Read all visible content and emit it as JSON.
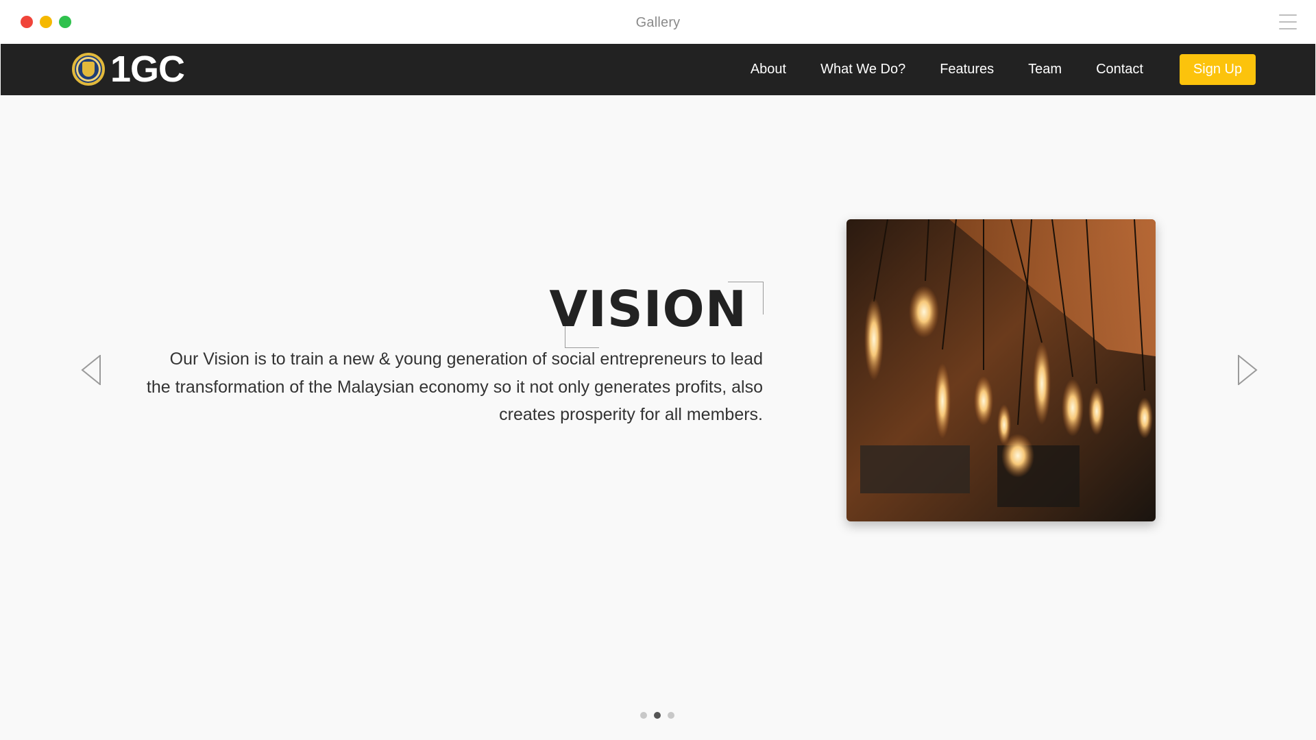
{
  "window": {
    "title": "Gallery"
  },
  "navbar": {
    "brand": "1GC",
    "links": [
      "About",
      "What We Do?",
      "Features",
      "Team",
      "Contact"
    ],
    "signup_label": "Sign Up",
    "accent_color": "#fcc30c",
    "background": "#222222"
  },
  "slide": {
    "title": "VISION",
    "text": "Our Vision is to train a new & young generation of social entrepreneurs to lead the transformation of the Malaysian economy so it not only generates profits, also creates prosperity for all members.",
    "image": "hanging-edison-bulbs-photo",
    "prev_icon": "triangle-left-icon",
    "next_icon": "triangle-right-icon",
    "pagination": {
      "total": 3,
      "active": 2
    }
  }
}
